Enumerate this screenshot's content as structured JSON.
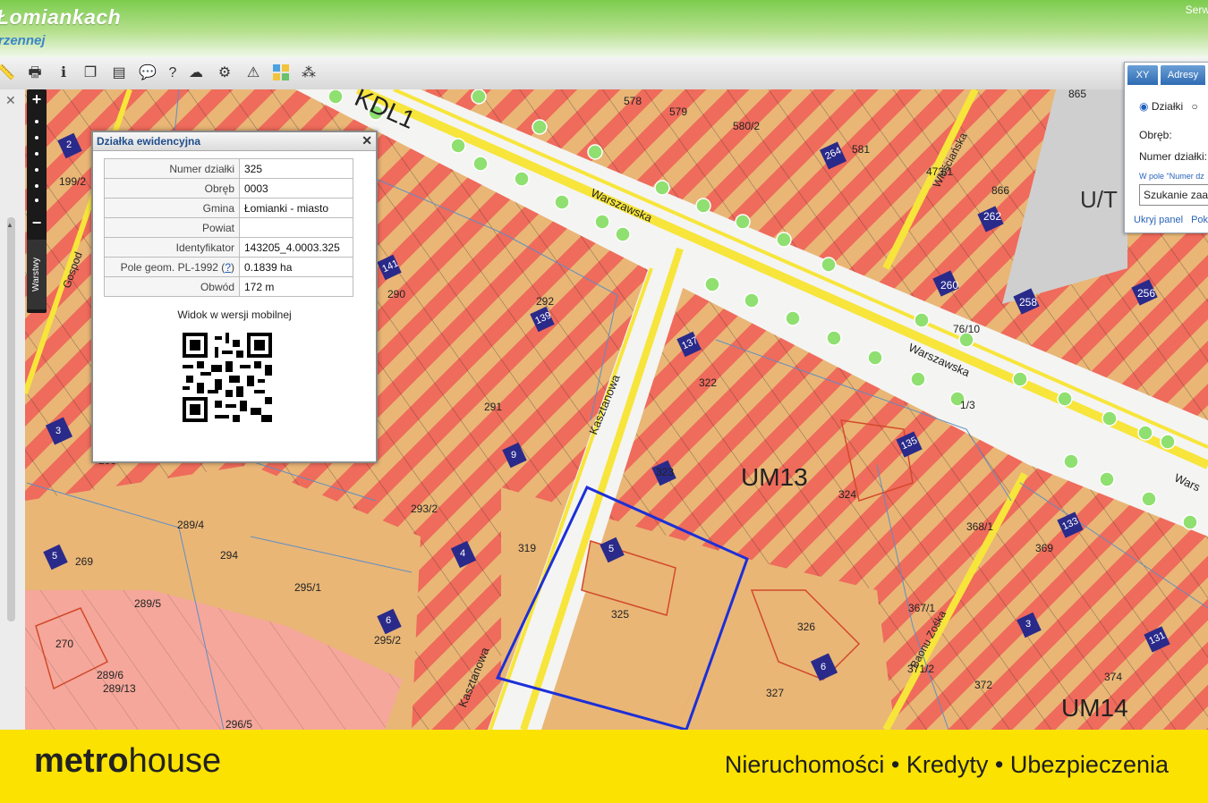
{
  "header": {
    "title": "Łomiankach",
    "subtitle": "rzennej",
    "service": "Serw"
  },
  "toolbar": {
    "tools": [
      "measure-icon",
      "print-icon",
      "info-icon",
      "copy-icon",
      "layout-icon",
      "comment-icon",
      "help-icon",
      "cloud-icon",
      "settings-icon",
      "warning-icon",
      "grid-color-icon",
      "legend-icon"
    ]
  },
  "map": {
    "zoom_in": "+",
    "zoom_out": "−",
    "layers_label": "Warstwy",
    "zones": [
      {
        "text": "KDL1"
      },
      {
        "text": "UM13"
      },
      {
        "text": "UM14"
      },
      {
        "text": "U/T"
      }
    ],
    "streets": [
      {
        "text": "Warszawska"
      },
      {
        "text": "Warszawska"
      },
      {
        "text": "Kasztanowa"
      },
      {
        "text": "Kasztanowa"
      },
      {
        "text": "Włościańska"
      },
      {
        "text": "Baonu Zośka"
      },
      {
        "text": "Gospod"
      },
      {
        "text": "Wars"
      }
    ],
    "parcels": [
      "578",
      "579",
      "580/2",
      "581",
      "865",
      "473/1",
      "866",
      "199/2",
      "290",
      "292",
      "291",
      "322",
      "76/10",
      "1/3",
      "324",
      "293/2",
      "319",
      "323",
      "289/4",
      "294",
      "295/1",
      "269",
      "289/5",
      "295/2",
      "270",
      "289/6",
      "289/13",
      "296/5",
      "325",
      "326",
      "327",
      "368/1",
      "369",
      "367/1",
      "371/2",
      "372",
      "374",
      "262",
      "260",
      "258",
      "256",
      "285"
    ],
    "buildings": [
      "264",
      "139",
      "137",
      "141",
      "135",
      "133",
      "131",
      "4",
      "5",
      "5",
      "6",
      "6",
      "3",
      "3",
      "2",
      "9"
    ]
  },
  "popup": {
    "title": "Działka ewidencyjna",
    "close": "✕",
    "rows": [
      {
        "key": "Numer działki",
        "value": "325"
      },
      {
        "key": "Obręb",
        "value": "0003"
      },
      {
        "key": "Gmina",
        "value": "Łomianki - miasto"
      },
      {
        "key": "Powiat",
        "value": ""
      },
      {
        "key": "Identyfikator",
        "value": "143205_4.0003.325"
      },
      {
        "key": "Pole geom. PL-1992",
        "value": "0.1839 ha"
      },
      {
        "key": "Obwód",
        "value": "172 m"
      }
    ],
    "help_mark": "?",
    "mobile_label": "Widok w wersji mobilnej"
  },
  "right_panel": {
    "tab_xy": "XY",
    "tab_addresses": "Adresy",
    "radio_label": "Działki",
    "obreb_label": "Obręb:",
    "numer_label": "Numer działki:",
    "hint": "W pole \"Numer dz",
    "search_button": "Szukanie zaa",
    "hide_link": "Ukryj panel",
    "show_link": "Pok"
  },
  "footer": {
    "brand_part1": "metro",
    "brand_part2": "house",
    "tagline": "Nieruchomości • Kredyty • Ubezpieczenia"
  },
  "colors": {
    "zone_red": "#f06a5a",
    "zone_tan": "#e8b472",
    "road_yellow": "#f7e53b",
    "road_white": "#f4f4f2",
    "green_dot": "#8fe070",
    "selected_parcel": "#1c2fd8",
    "footer_yellow": "#fbe200"
  }
}
